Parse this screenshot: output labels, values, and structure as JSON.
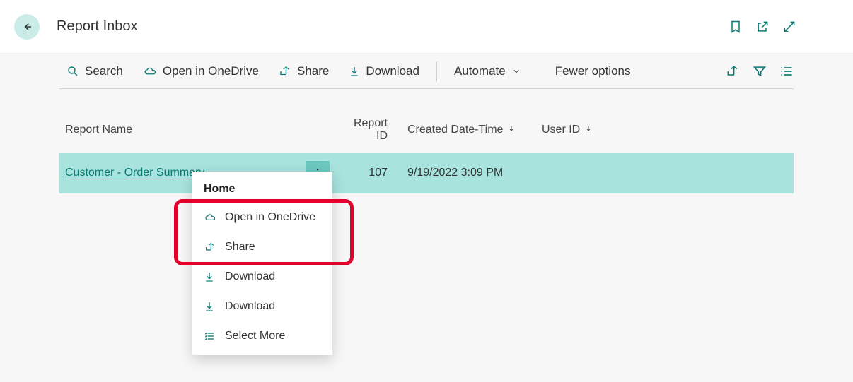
{
  "header": {
    "title": "Report Inbox"
  },
  "toolbar": {
    "search": "Search",
    "open_onedrive": "Open in OneDrive",
    "share": "Share",
    "download": "Download",
    "automate": "Automate",
    "fewer": "Fewer options"
  },
  "table": {
    "headers": {
      "name": "Report Name",
      "id": "Report ID",
      "created": "Created Date-Time",
      "user": "User ID"
    },
    "rows": [
      {
        "name": "Customer - Order Summary",
        "id": "107",
        "created": "9/19/2022 3:09 PM",
        "user": ""
      }
    ]
  },
  "context_menu": {
    "header": "Home",
    "items": [
      {
        "label": "Open in OneDrive",
        "icon": "cloud"
      },
      {
        "label": "Share",
        "icon": "share"
      },
      {
        "label": "Download",
        "icon": "download"
      },
      {
        "label": "Download",
        "icon": "download"
      },
      {
        "label": "Select More",
        "icon": "list"
      }
    ]
  }
}
